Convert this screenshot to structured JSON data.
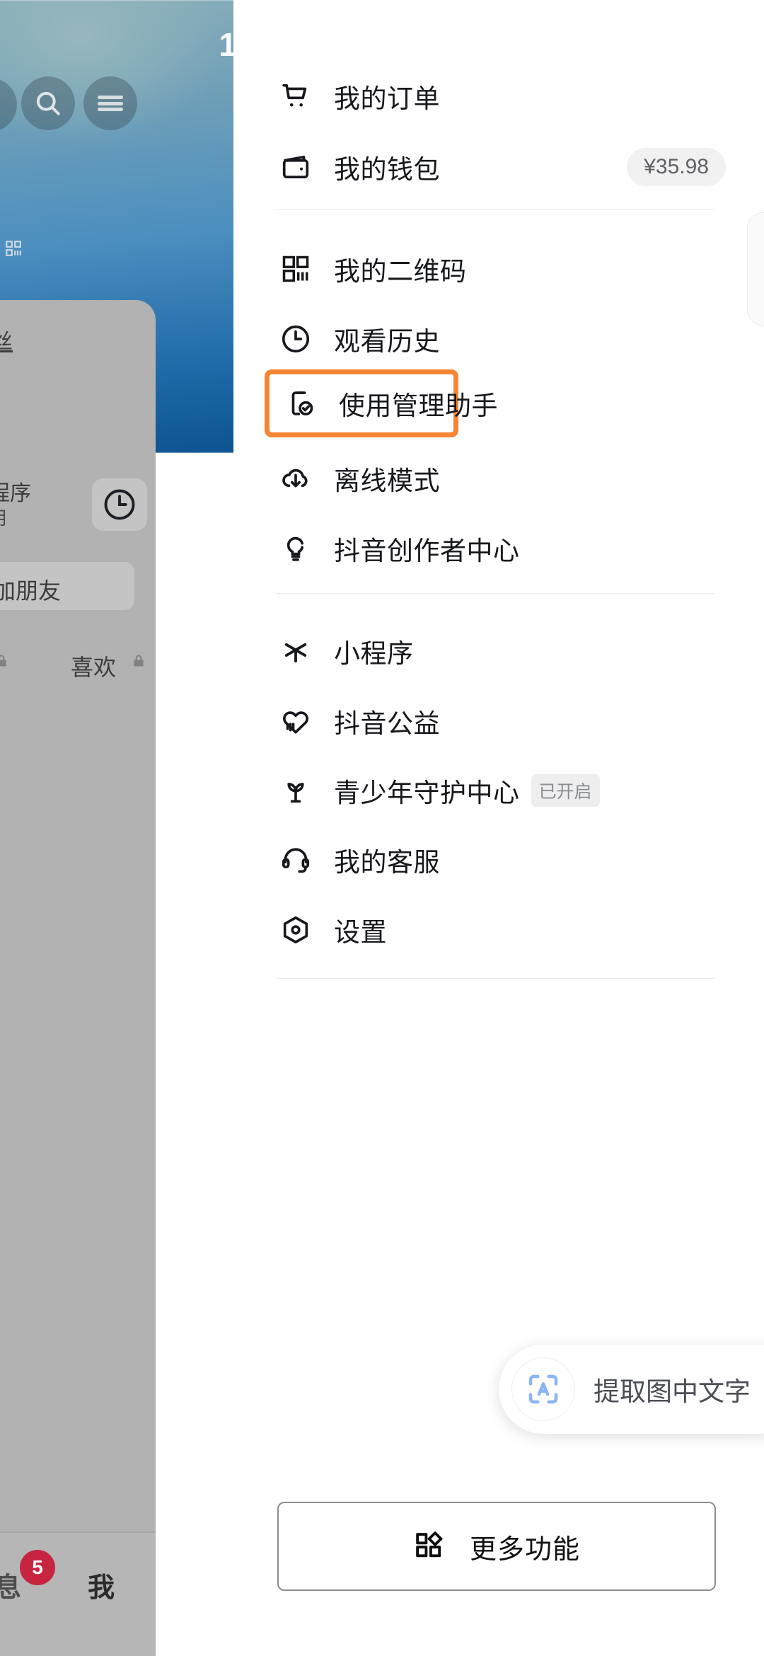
{
  "background": {
    "status_number": "1",
    "icons": {
      "avatar": "avatar-icon",
      "search": "search-icon",
      "menu": "hamburger-menu-icon",
      "qr_mini": "qr-code-icon",
      "clock_chip": "clock-icon",
      "lock": "lock-icon"
    },
    "texts": {
      "fans_partial": "丝",
      "program_partial": "程序",
      "program_sub_partial": "用",
      "add_friend_partial": "加朋友",
      "likes": "喜欢"
    },
    "bottom_nav": {
      "message_label": "息",
      "message_badge": "5",
      "me_label": "我"
    }
  },
  "drawer": {
    "groups": [
      {
        "items": [
          {
            "icon": "shopping-cart-icon",
            "label": "我的订单",
            "value": ""
          },
          {
            "icon": "wallet-icon",
            "label": "我的钱包",
            "value": "¥35.98"
          }
        ]
      },
      {
        "items": [
          {
            "icon": "qr-code-icon",
            "label": "我的二维码",
            "value": ""
          },
          {
            "icon": "clock-icon",
            "label": "观看历史",
            "value": ""
          },
          {
            "icon": "phone-check-icon",
            "label": "使用管理助手",
            "value": "",
            "highlighted": true
          },
          {
            "icon": "cloud-download-icon",
            "label": "离线模式",
            "value": ""
          },
          {
            "icon": "lightbulb-icon",
            "label": "抖音创作者中心",
            "value": ""
          }
        ]
      },
      {
        "items": [
          {
            "icon": "starburst-icon",
            "label": "小程序",
            "value": ""
          },
          {
            "icon": "heart-pulse-icon",
            "label": "抖音公益",
            "value": ""
          },
          {
            "icon": "sprout-icon",
            "label": "青少年守护中心",
            "tag": "已开启"
          },
          {
            "icon": "headset-icon",
            "label": "我的客服",
            "value": ""
          },
          {
            "icon": "hexagon-gear-icon",
            "label": "设置",
            "value": ""
          }
        ]
      }
    ],
    "more_button": {
      "icon": "grid-apps-icon",
      "label": "更多功能"
    }
  },
  "ocr_pill": {
    "icon": "scan-text-icon",
    "label": "提取图中文字",
    "accent": "#8ab4f8"
  },
  "colors": {
    "highlight_border": "#f68534",
    "text_primary": "#16181c",
    "text_muted": "#8a8d93",
    "badge_bg": "#f1f1f2",
    "badge_red": "#c7243f",
    "panel_bg": "#ffffff"
  }
}
